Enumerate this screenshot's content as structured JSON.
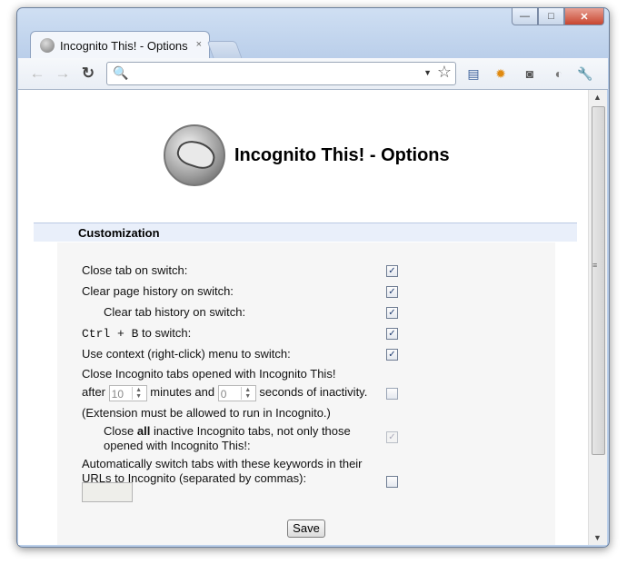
{
  "window": {
    "minimize_glyph": "—",
    "maximize_glyph": "□",
    "close_glyph": "✕"
  },
  "tab": {
    "title": "Incognito This! - Options",
    "close_glyph": "×"
  },
  "toolbar": {
    "back_glyph": "←",
    "forward_glyph": "→",
    "reload_glyph": "↻",
    "search_glyph": "🔍",
    "dropdown_glyph": "▼",
    "star_glyph": "☆",
    "address_value": ""
  },
  "extensions": [
    {
      "icon": "window-list-icon",
      "glyph": "▤"
    },
    {
      "icon": "gear-extension-icon",
      "glyph": "✹"
    },
    {
      "icon": "camera-extension-icon",
      "glyph": "◙"
    },
    {
      "icon": "incognito-hat-icon",
      "glyph": "◐"
    },
    {
      "icon": "wrench-icon",
      "glyph": "🔧"
    }
  ],
  "page": {
    "title": "Incognito This! - Options",
    "section": "Customization",
    "options": {
      "close_tab": {
        "label": "Close tab on switch:",
        "checked": true
      },
      "clear_page_history": {
        "label": "Clear page history on switch:",
        "checked": true
      },
      "clear_tab_history": {
        "label": "Clear tab history on switch:",
        "checked": true
      },
      "ctrl_b": {
        "key_combo": "Ctrl + B",
        "label": " to switch:",
        "checked": true
      },
      "context_menu": {
        "label": "Use context (right-click) menu to switch:",
        "checked": true
      },
      "close_inactive": {
        "line1": "Close Incognito tabs opened with Incognito This!",
        "after": "after",
        "minutes_value": "10",
        "minutes_label": "minutes and",
        "seconds_value": "0",
        "seconds_label": "seconds of inactivity.",
        "note": "(Extension must be allowed to run in Incognito.)",
        "checked": false
      },
      "close_all": {
        "pre": "Close ",
        "bold": "all",
        "post": " inactive Incognito tabs, not only those",
        "line2": "opened with Incognito This!:",
        "checked": true,
        "disabled": true
      },
      "auto_switch": {
        "line1": "Automatically switch tabs with these keywords in their",
        "line2": "URLs to Incognito (separated by commas):",
        "value": "",
        "checked": false
      }
    },
    "save_label": "Save"
  },
  "scrollbar": {
    "up_glyph": "▲",
    "down_glyph": "▼",
    "grip_glyph": "≡"
  }
}
